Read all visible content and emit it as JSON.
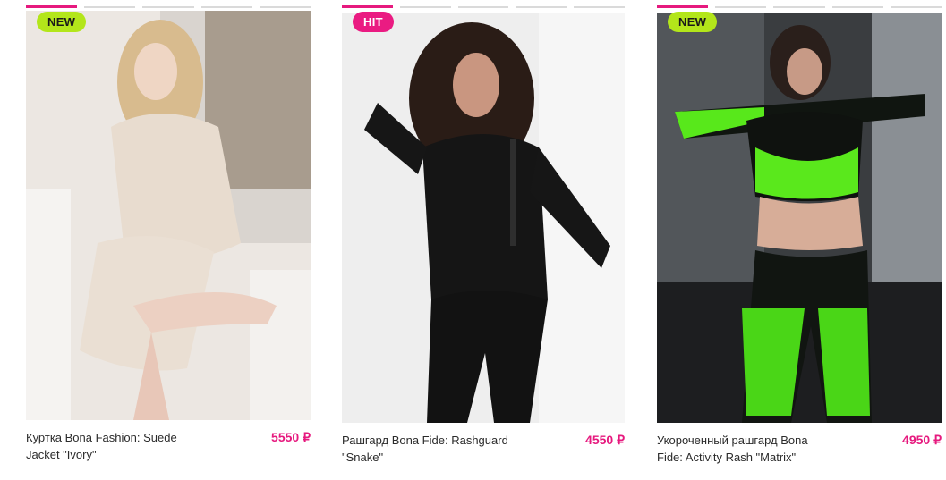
{
  "products": [
    {
      "badge": "NEW",
      "name": "Куртка Bona Fashion: Suede Jacket \"Ivory\"",
      "price": "5550 ₽",
      "slides": 5,
      "active_slide": 0
    },
    {
      "badge": "HIT",
      "name": "Рашгард Bona Fide: Rashguard \"Snake\"",
      "price": "4550 ₽",
      "slides": 5,
      "active_slide": 0
    },
    {
      "badge": "NEW",
      "name": "Укороченный рашгард Bona Fide: Activity Rash \"Matrix\"",
      "price": "4950 ₽",
      "slides": 5,
      "active_slide": 0
    }
  ],
  "colors": {
    "accent": "#e6197e",
    "badge_new": "#b3e61a",
    "badge_hit": "#ea1b82"
  }
}
